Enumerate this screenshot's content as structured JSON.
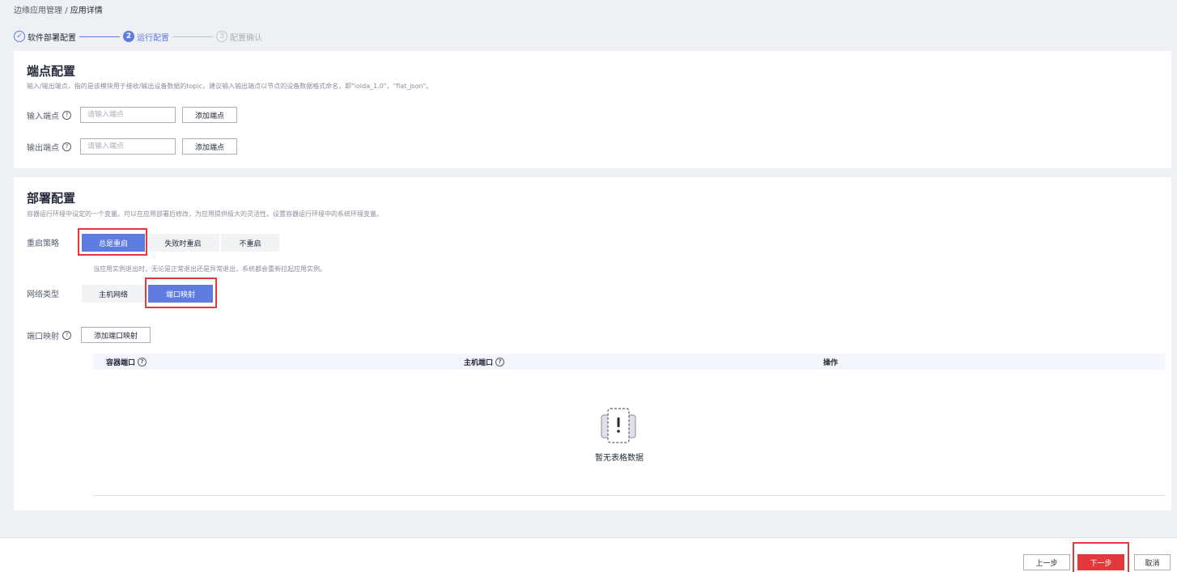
{
  "breadcrumb": {
    "parent": "边缘应用管理",
    "separator": "/",
    "current": "应用详情"
  },
  "steps": [
    {
      "num": "✓",
      "label": "软件部署配置",
      "state": "done"
    },
    {
      "num": "2",
      "label": "运行配置",
      "state": "active"
    },
    {
      "num": "3",
      "label": "配置确认",
      "state": "todo"
    }
  ],
  "endpoint": {
    "title": "端点配置",
    "desc": "输入/输出端点，指的是该模块用于接收/输出设备数据的topic，建议输入输出端点以节点的设备数据格式命名，即\"iolda_1.0\"，\"flat_json\"。",
    "input_label": "输入端点",
    "input_placeholder": "请输入端点",
    "output_label": "输出端点",
    "output_placeholder": "请输入端点",
    "add_button": "添加端点"
  },
  "deploy": {
    "title": "部署配置",
    "desc": "容器运行环境中设定的一个变量。可以在应用部署后修改，为应用提供极大的灵活性。设置容器运行环境中的系统环境变量。",
    "restart_label": "重启策略",
    "restart_options": [
      "总是重启",
      "失败时重启",
      "不重启"
    ],
    "restart_selected": "总是重启",
    "restart_hint": "当应用实例退出时，无论是正常退出还是异常退出，系统都会重新拉起应用实例。",
    "network_label": "网络类型",
    "network_options": [
      "主机网络",
      "端口映射"
    ],
    "network_selected": "端口映射",
    "port_label": "端口映射",
    "add_port_button": "添加端口映射",
    "table_headers": [
      "容器端口",
      "主机端口",
      "操作"
    ],
    "empty_text": "暂无表格数据"
  },
  "footer": {
    "prev": "上一步",
    "next": "下一步",
    "cancel": "取消"
  },
  "colors": {
    "primary": "#5e7ce0",
    "danger": "#e4393c",
    "highlight": "#e4393c"
  }
}
